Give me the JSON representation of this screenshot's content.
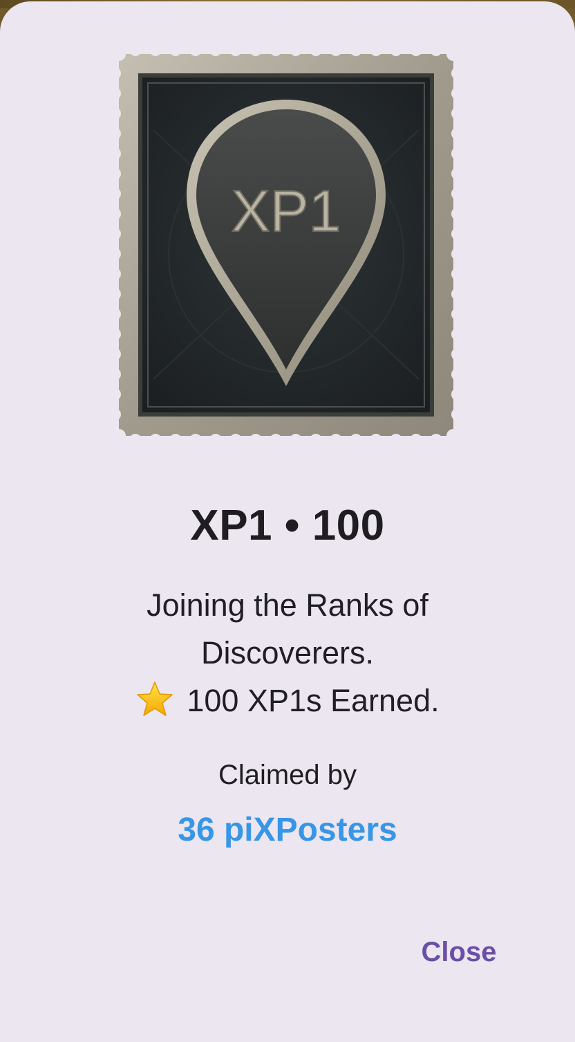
{
  "badge": {
    "stamp_text": "XP1",
    "title": "XP1 • 100",
    "description_line1": "Joining the Ranks of",
    "description_line2": "Discoverers.",
    "earned_icon": "star-icon",
    "earned_text": "100 XP1s Earned."
  },
  "claimed": {
    "label": "Claimed by",
    "link_text": "36 piXPosters"
  },
  "actions": {
    "close_label": "Close"
  },
  "colors": {
    "dialog_background": "#ebe6f0",
    "link": "#3796e6",
    "close_button": "#6a4fa6",
    "stamp_frame": "#a8a294",
    "stamp_inner": "#22272a"
  }
}
